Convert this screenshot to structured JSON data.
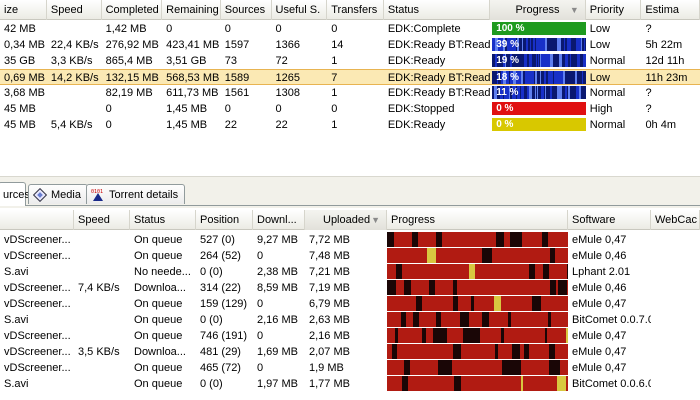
{
  "colors": {
    "complete": "#1e9a1e",
    "download_blue": "#1830c8",
    "stopped_red": "#e01010",
    "ready_yellow": "#d8c800",
    "source_red": "#b11b12"
  },
  "downloads": {
    "columns": [
      "ize",
      "Speed",
      "Completed",
      "Remaining",
      "Sources",
      "Useful S.",
      "Transfers",
      "Status",
      "Progress",
      "Priority",
      "Estima"
    ],
    "sorted_column": "Progress",
    "rows": [
      {
        "size": "42 MB",
        "speed": "",
        "completed": "1,42 MB",
        "remaining": "0",
        "sources": "0",
        "useful": "0",
        "transfers": "0",
        "status": "EDK:Complete",
        "progress_label": "100 %",
        "progress": 1.0,
        "bar": "complete",
        "priority": "Low",
        "estimate": "?"
      },
      {
        "size": "0,34 MB",
        "speed": "22,4 KB/s",
        "completed": "276,92 MB",
        "remaining": "423,41 MB",
        "sources": "1597",
        "useful": "1366",
        "transfers": "14",
        "status": "EDK:Ready BT:Ready",
        "progress_label": "39 %",
        "progress": 0.39,
        "bar": "download",
        "priority": "Low",
        "estimate": "5h 22m"
      },
      {
        "size": "35 GB",
        "speed": "3,3 KB/s",
        "completed": "865,4 MB",
        "remaining": "3,51 GB",
        "sources": "73",
        "useful": "72",
        "transfers": "1",
        "status": "EDK:Ready",
        "progress_label": "19 %",
        "progress": 0.19,
        "bar": "download",
        "priority": "Normal",
        "estimate": "12d 11h"
      },
      {
        "size": "0,69 MB",
        "speed": "14,2 KB/s",
        "completed": "132,15 MB",
        "remaining": "568,53 MB",
        "sources": "1589",
        "useful": "1265",
        "transfers": "7",
        "status": "EDK:Ready BT:Ready",
        "progress_label": "18 %",
        "progress": 0.18,
        "bar": "download",
        "priority": "Low",
        "estimate": "11h 23m",
        "selected": true
      },
      {
        "size": "3,68 MB",
        "speed": "",
        "completed": "82,19 MB",
        "remaining": "611,73 MB",
        "sources": "1561",
        "useful": "1308",
        "transfers": "1",
        "status": "EDK:Ready BT:Ready",
        "progress_label": "11 %",
        "progress": 0.11,
        "bar": "download",
        "priority": "Normal",
        "estimate": "?"
      },
      {
        "size": "45 MB",
        "speed": "",
        "completed": "0",
        "remaining": "1,45 MB",
        "sources": "0",
        "useful": "0",
        "transfers": "0",
        "status": "EDK:Stopped",
        "progress_label": "0 %",
        "progress": 0.0,
        "bar": "stopped",
        "priority": "High",
        "estimate": "?"
      },
      {
        "size": "45 MB",
        "speed": "5,4 KB/s",
        "completed": "0",
        "remaining": "1,45 MB",
        "sources": "22",
        "useful": "22",
        "transfers": "1",
        "status": "EDK:Ready",
        "progress_label": "0 %",
        "progress": 0.0,
        "bar": "ready",
        "priority": "Normal",
        "estimate": "0h 4m"
      }
    ]
  },
  "tabs": [
    {
      "label": "urces",
      "icon": "sources-icon",
      "active": true
    },
    {
      "label": "Media",
      "icon": "media-icon",
      "active": false
    },
    {
      "label": "Torrent details",
      "icon": "torrent-icon",
      "active": false
    }
  ],
  "sources": {
    "columns": [
      "",
      "Speed",
      "Status",
      "Position",
      "Downl...",
      "Uploaded",
      "Progress",
      "Software",
      "WebCac"
    ],
    "sorted_column": "Uploaded",
    "rows": [
      {
        "name": "vDScreener...",
        "speed": "",
        "status": "On queue",
        "position": "527 (0)",
        "downloaded": "9,27 MB",
        "uploaded": "7,72 MB",
        "software": "eMule 0,47"
      },
      {
        "name": "vDScreener...",
        "speed": "",
        "status": "On queue",
        "position": "264 (52)",
        "downloaded": "0",
        "uploaded": "7,48 MB",
        "software": "eMule 0,46"
      },
      {
        "name": "S.avi",
        "speed": "",
        "status": "No neede...",
        "position": "0 (0)",
        "downloaded": "2,38 MB",
        "uploaded": "7,21 MB",
        "software": "Lphant 2.01"
      },
      {
        "name": "vDScreener...",
        "speed": "7,4 KB/s",
        "status": "Downloa...",
        "position": "314 (22)",
        "downloaded": "8,59 MB",
        "uploaded": "7,19 MB",
        "software": "eMule 0,46"
      },
      {
        "name": "vDScreener...",
        "speed": "",
        "status": "On queue",
        "position": "159 (129)",
        "downloaded": "0",
        "uploaded": "6,79 MB",
        "software": "eMule 0,47"
      },
      {
        "name": "S.avi",
        "speed": "",
        "status": "On queue",
        "position": "0 (0)",
        "downloaded": "2,16 MB",
        "uploaded": "2,63 MB",
        "software": "BitComet 0.0.7.0"
      },
      {
        "name": "vDScreener...",
        "speed": "",
        "status": "On queue",
        "position": "746 (191)",
        "downloaded": "0",
        "uploaded": "2,16 MB",
        "software": "eMule 0,47"
      },
      {
        "name": "vDScreener...",
        "speed": "3,5 KB/s",
        "status": "Downloa...",
        "position": "481 (29)",
        "downloaded": "1,69 MB",
        "uploaded": "2,07 MB",
        "software": "eMule 0,47"
      },
      {
        "name": "vDScreener...",
        "speed": "",
        "status": "On queue",
        "position": "465 (72)",
        "downloaded": "0",
        "uploaded": "1,9 MB",
        "software": "eMule 0,47"
      },
      {
        "name": "S.avi",
        "speed": "",
        "status": "On queue",
        "position": "0 (0)",
        "downloaded": "1,97 MB",
        "uploaded": "1,77 MB",
        "software": "BitComet 0.0.6.0"
      }
    ]
  }
}
